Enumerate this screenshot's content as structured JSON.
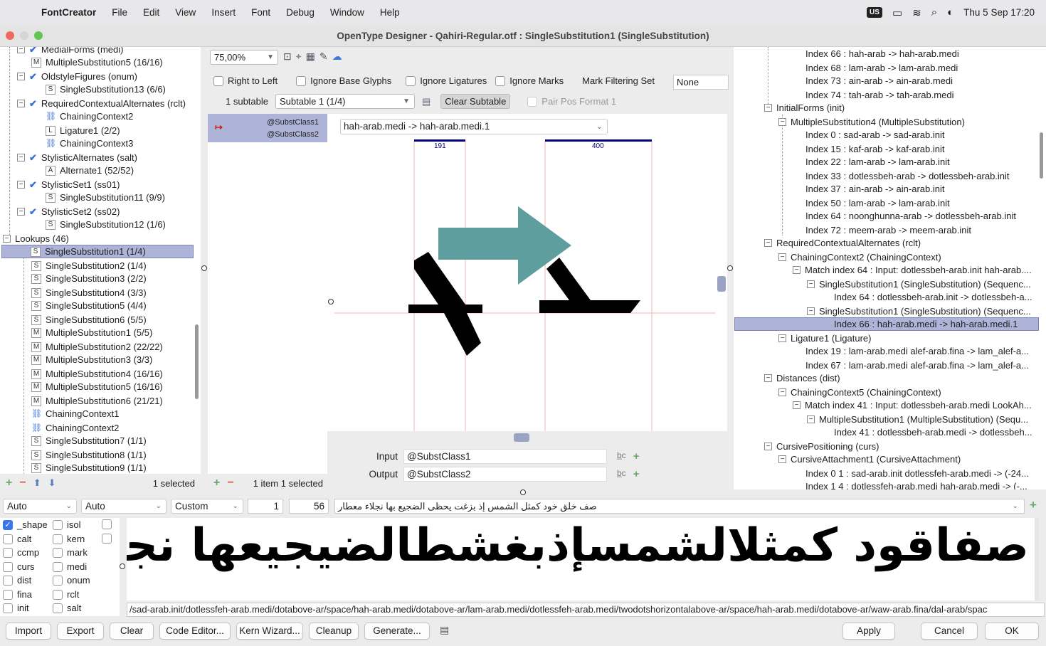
{
  "menubar": {
    "app": "FontCreator",
    "items": [
      "File",
      "Edit",
      "View",
      "Insert",
      "Font",
      "Debug",
      "Window",
      "Help"
    ],
    "input_source": "US",
    "clock": "Thu 5 Sep  17:20"
  },
  "window": {
    "title": "OpenType Designer - Qahiri-Regular.otf : SingleSubstitution1 (SingleSubstitution)"
  },
  "left_tree": {
    "rows": [
      {
        "label": "MedialForms (medi)"
      },
      {
        "label": "MultipleSubstitution5 (16/16)"
      },
      {
        "label": "OldstyleFigures (onum)"
      },
      {
        "label": "SingleSubstitution13 (6/6)"
      },
      {
        "label": "RequiredContextualAlternates (rclt)"
      },
      {
        "label": "ChainingContext2"
      },
      {
        "label": "Ligature1 (2/2)"
      },
      {
        "label": "ChainingContext3"
      },
      {
        "label": "StylisticAlternates (salt)"
      },
      {
        "label": "Alternate1 (52/52)"
      },
      {
        "label": "StylisticSet1 (ss01)"
      },
      {
        "label": "SingleSubstitution11 (9/9)"
      },
      {
        "label": "StylisticSet2 (ss02)"
      },
      {
        "label": "SingleSubstitution12 (1/6)"
      },
      {
        "label": "Lookups (46)"
      },
      {
        "label": "SingleSubstitution1 (1/4)"
      },
      {
        "label": "SingleSubstitution2 (1/4)"
      },
      {
        "label": "SingleSubstitution3 (2/2)"
      },
      {
        "label": "SingleSubstitution4 (3/3)"
      },
      {
        "label": "SingleSubstitution5 (4/4)"
      },
      {
        "label": "SingleSubstitution6 (5/5)"
      },
      {
        "label": "MultipleSubstitution1 (5/5)"
      },
      {
        "label": "MultipleSubstitution2 (22/22)"
      },
      {
        "label": "MultipleSubstitution3 (3/3)"
      },
      {
        "label": "MultipleSubstitution4 (16/16)"
      },
      {
        "label": "MultipleSubstitution5 (16/16)"
      },
      {
        "label": "MultipleSubstitution6 (21/21)"
      },
      {
        "label": "ChainingContext1"
      },
      {
        "label": "ChainingContext2"
      },
      {
        "label": "SingleSubstitution7 (1/1)"
      },
      {
        "label": "SingleSubstitution8 (1/1)"
      },
      {
        "label": "SingleSubstitution9 (1/1)"
      }
    ],
    "footer_status": "1 selected"
  },
  "editor": {
    "zoom": "75,00%",
    "options": {
      "right_to_left": "Right to Left",
      "ignore_base": "Ignore Base Glyphs",
      "ignore_lig": "Ignore Ligatures",
      "ignore_marks": "Ignore Marks",
      "mark_filtering_label": "Mark Filtering Set",
      "mark_filtering_value": "None"
    },
    "subtable_label": "1 subtable",
    "subtable_value": "Subtable 1 (1/4)",
    "clear_subtable": "Clear Subtable",
    "pair_pos": "Pair Pos Format 1",
    "class_item": {
      "arrow": "↦",
      "class1": "@SubstClass1",
      "class2": "@SubstClass2"
    },
    "glyph_pair": "hah-arab.medi -> hah-arab.medi.1",
    "advance_left": "191",
    "advance_right": "400",
    "input_label": "Input",
    "input_value": "@SubstClass1",
    "output_label": "Output",
    "output_value": "@SubstClass2",
    "footer_status": "1 item 1 selected"
  },
  "right_tree": {
    "rows": [
      {
        "label": "Index 66 : hah-arab -> hah-arab.medi"
      },
      {
        "label": "Index 68 : lam-arab -> lam-arab.medi"
      },
      {
        "label": "Index 73 : ain-arab -> ain-arab.medi"
      },
      {
        "label": "Index 74 : tah-arab -> tah-arab.medi"
      },
      {
        "label": "InitialForms (init)"
      },
      {
        "label": "MultipleSubstitution4 (MultipleSubstitution)"
      },
      {
        "label": "Index 0 : sad-arab -> sad-arab.init"
      },
      {
        "label": "Index 15 : kaf-arab -> kaf-arab.init"
      },
      {
        "label": "Index 22 : lam-arab -> lam-arab.init"
      },
      {
        "label": "Index 33 : dotlessbeh-arab -> dotlessbeh-arab.init"
      },
      {
        "label": "Index 37 : ain-arab -> ain-arab.init"
      },
      {
        "label": "Index 50 : lam-arab -> lam-arab.init"
      },
      {
        "label": "Index 64 : noonghunna-arab -> dotlessbeh-arab.init"
      },
      {
        "label": "Index 72 : meem-arab -> meem-arab.init"
      },
      {
        "label": "RequiredContextualAlternates (rclt)"
      },
      {
        "label": "ChainingContext2 (ChainingContext)"
      },
      {
        "label": "Match index 64 : Input: dotlessbeh-arab.init hah-arab...."
      },
      {
        "label": "SingleSubstitution1 (SingleSubstitution) (Sequenc..."
      },
      {
        "label": "Index 64 : dotlessbeh-arab.init -> dotlessbeh-a..."
      },
      {
        "label": "SingleSubstitution1 (SingleSubstitution) (Sequenc..."
      },
      {
        "label": "Index 66 : hah-arab.medi -> hah-arab.medi.1"
      },
      {
        "label": "Ligature1 (Ligature)"
      },
      {
        "label": "Index 19 : lam-arab.medi alef-arab.fina  -> lam_alef-a..."
      },
      {
        "label": "Index 67 : lam-arab.medi alef-arab.fina  -> lam_alef-a..."
      },
      {
        "label": "Distances (dist)"
      },
      {
        "label": "ChainingContext5 (ChainingContext)"
      },
      {
        "label": "Match index 41 : Input: dotlessbeh-arab.medi LookAh..."
      },
      {
        "label": "MultipleSubstitution1 (MultipleSubstitution) (Sequ..."
      },
      {
        "label": "Index 41 : dotlessbeh-arab.medi -> dotlessbeh..."
      },
      {
        "label": "CursivePositioning (curs)"
      },
      {
        "label": "CursiveAttachment1 (CursiveAttachment)"
      },
      {
        "label": "Index 0 1 : sad-arab.init dotlessfeh-arab.medi -> (-24..."
      },
      {
        "label": "Index 1 4 : dotlessfeh-arab.medi hah-arab.medi -> (-..."
      }
    ]
  },
  "preview": {
    "dd1": "Auto",
    "dd2": "Auto",
    "dd3": "Custom",
    "num1": "1",
    "num2": "56",
    "sample_text": "صف خلق خود كمثل الشمس إذ بزغت يحظى الضجيع بها نجلاء معطار",
    "features": [
      {
        "label": "_shape",
        "checked": true
      },
      {
        "label": "isol",
        "checked": false
      },
      {
        "label": "calt",
        "checked": false
      },
      {
        "label": "kern",
        "checked": false
      },
      {
        "label": "ccmp",
        "checked": false
      },
      {
        "label": "mark",
        "checked": false
      },
      {
        "label": "curs",
        "checked": false
      },
      {
        "label": "medi",
        "checked": false
      },
      {
        "label": "dist",
        "checked": false
      },
      {
        "label": "onum",
        "checked": false
      },
      {
        "label": "fina",
        "checked": false
      },
      {
        "label": "rclt",
        "checked": false
      },
      {
        "label": "init",
        "checked": false
      },
      {
        "label": "salt",
        "checked": false
      }
    ],
    "rendered_text": "صفاقود كمثلالشمسإذبغشطالضيجيعها نجلاء معطار",
    "glyph_path": "/sad-arab.init/dotlessfeh-arab.medi/dotabove-ar/space/hah-arab.medi/dotabove-ar/lam-arab.medi/dotlessfeh-arab.medi/twodotshorizontalabove-ar/space/hah-arab.medi/dotabove-ar/waw-arab.fina/dal-arab/spac"
  },
  "buttons": {
    "import": "Import",
    "export": "Export",
    "clear": "Clear",
    "code_editor": "Code Editor...",
    "kern_wizard": "Kern Wizard...",
    "cleanup": "Cleanup",
    "generate": "Generate...",
    "apply": "Apply",
    "cancel": "Cancel",
    "ok": "OK"
  }
}
